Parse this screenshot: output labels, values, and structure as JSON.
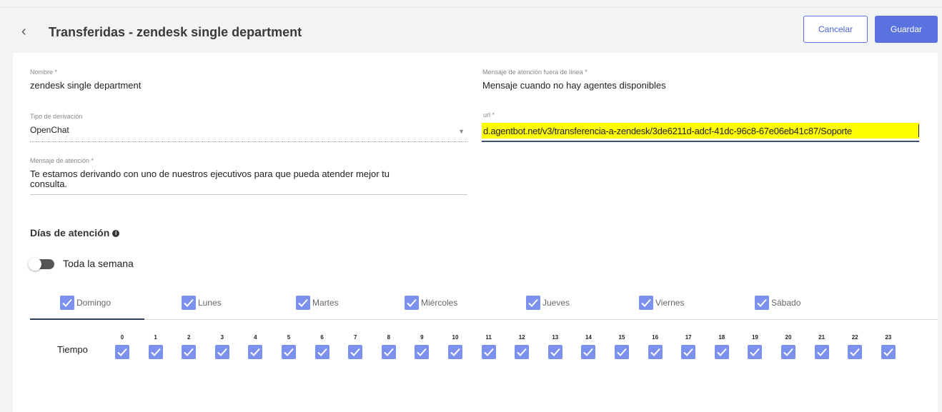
{
  "header": {
    "back_icon": "chevron-left-icon",
    "title": "Transferidas - zendesk single department",
    "cancel_label": "Cancelar",
    "save_label": "Guardar"
  },
  "form": {
    "nombre": {
      "label": "Nombre *",
      "value": "zendesk single department"
    },
    "mensaje_fuera_linea": {
      "label": "Mensaje de atención fuera de línea *",
      "value": "Mensaje cuando no hay agentes disponibles"
    },
    "tipo_derivacion": {
      "label": "Tipo de derivación",
      "value": "OpenChat"
    },
    "url": {
      "label": "url *",
      "value": "d.agentbot.net/v3/transferencia-a-zendesk/3de6211d-adcf-41dc-96c8-67e06eb41c87/Soporte"
    },
    "mensaje_atencion": {
      "label": "Mensaje de atención *",
      "value_line1": "Te estamos derivando con uno de nuestros ejecutivos para que pueda atender mejor tu",
      "value_line2": "consulta."
    }
  },
  "dias": {
    "heading": "Días de atención",
    "toggle_label": "Toda la semana",
    "toggle_on": false,
    "tabs": [
      {
        "label": "Domingo",
        "checked": true,
        "active": true
      },
      {
        "label": "Lunes",
        "checked": true,
        "active": false
      },
      {
        "label": "Martes",
        "checked": true,
        "active": false
      },
      {
        "label": "Miércoles",
        "checked": true,
        "active": false
      },
      {
        "label": "Jueves",
        "checked": true,
        "active": false
      },
      {
        "label": "Viernes",
        "checked": true,
        "active": false
      },
      {
        "label": "Sábado",
        "checked": true,
        "active": false
      }
    ]
  },
  "tiempo": {
    "label": "Tiempo",
    "hours": [
      "0",
      "1",
      "2",
      "3",
      "4",
      "5",
      "6",
      "7",
      "8",
      "9",
      "10",
      "11",
      "12",
      "13",
      "14",
      "15",
      "16",
      "17",
      "18",
      "19",
      "20",
      "21",
      "22",
      "23"
    ]
  },
  "colors": {
    "accent": "#5a72e0",
    "checkbox": "#7c90ee",
    "highlight": "#ffff00"
  }
}
